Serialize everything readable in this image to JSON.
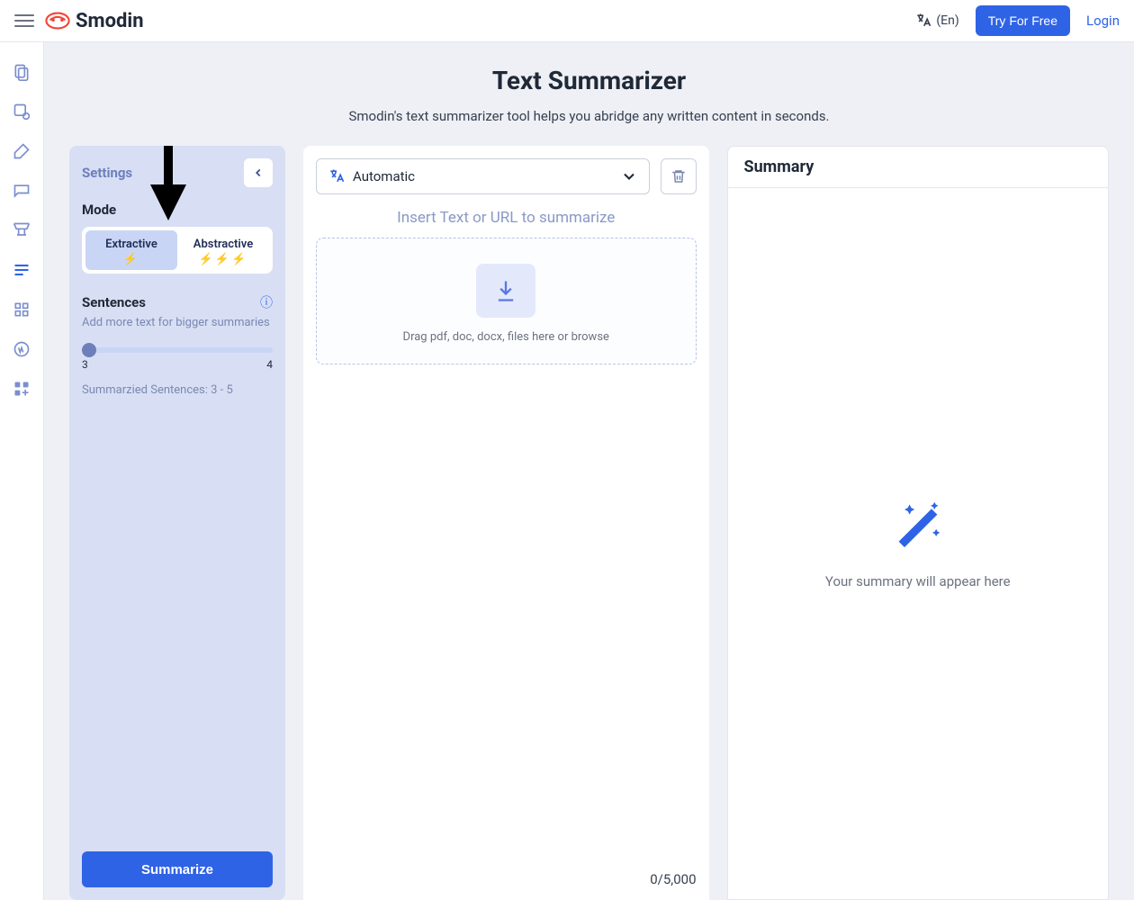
{
  "header": {
    "brand": "Smodin",
    "lang_label": "(En)",
    "try_free": "Try For Free",
    "login": "Login"
  },
  "page": {
    "title": "Text Summarizer",
    "subtitle": "Smodin's text summarizer tool helps you abridge any written content in seconds."
  },
  "settings": {
    "title": "Settings",
    "mode_label": "Mode",
    "modes": {
      "extractive": "Extractive",
      "abstractive": "Abstractive"
    },
    "sentences_label": "Sentences",
    "sentences_hint": "Add more text for bigger summaries",
    "slider_min": "3",
    "slider_max": "4",
    "summary_count": "Summarzied Sentences: 3 - 5",
    "summarize_btn": "Summarize"
  },
  "input": {
    "lang_selected": "Automatic",
    "placeholder_title": "Insert Text or URL to summarize",
    "drop_text": "Drag pdf, doc, docx, files here or browse",
    "counter": "0/5,000"
  },
  "summary": {
    "title": "Summary",
    "empty": "Your summary will appear here"
  }
}
